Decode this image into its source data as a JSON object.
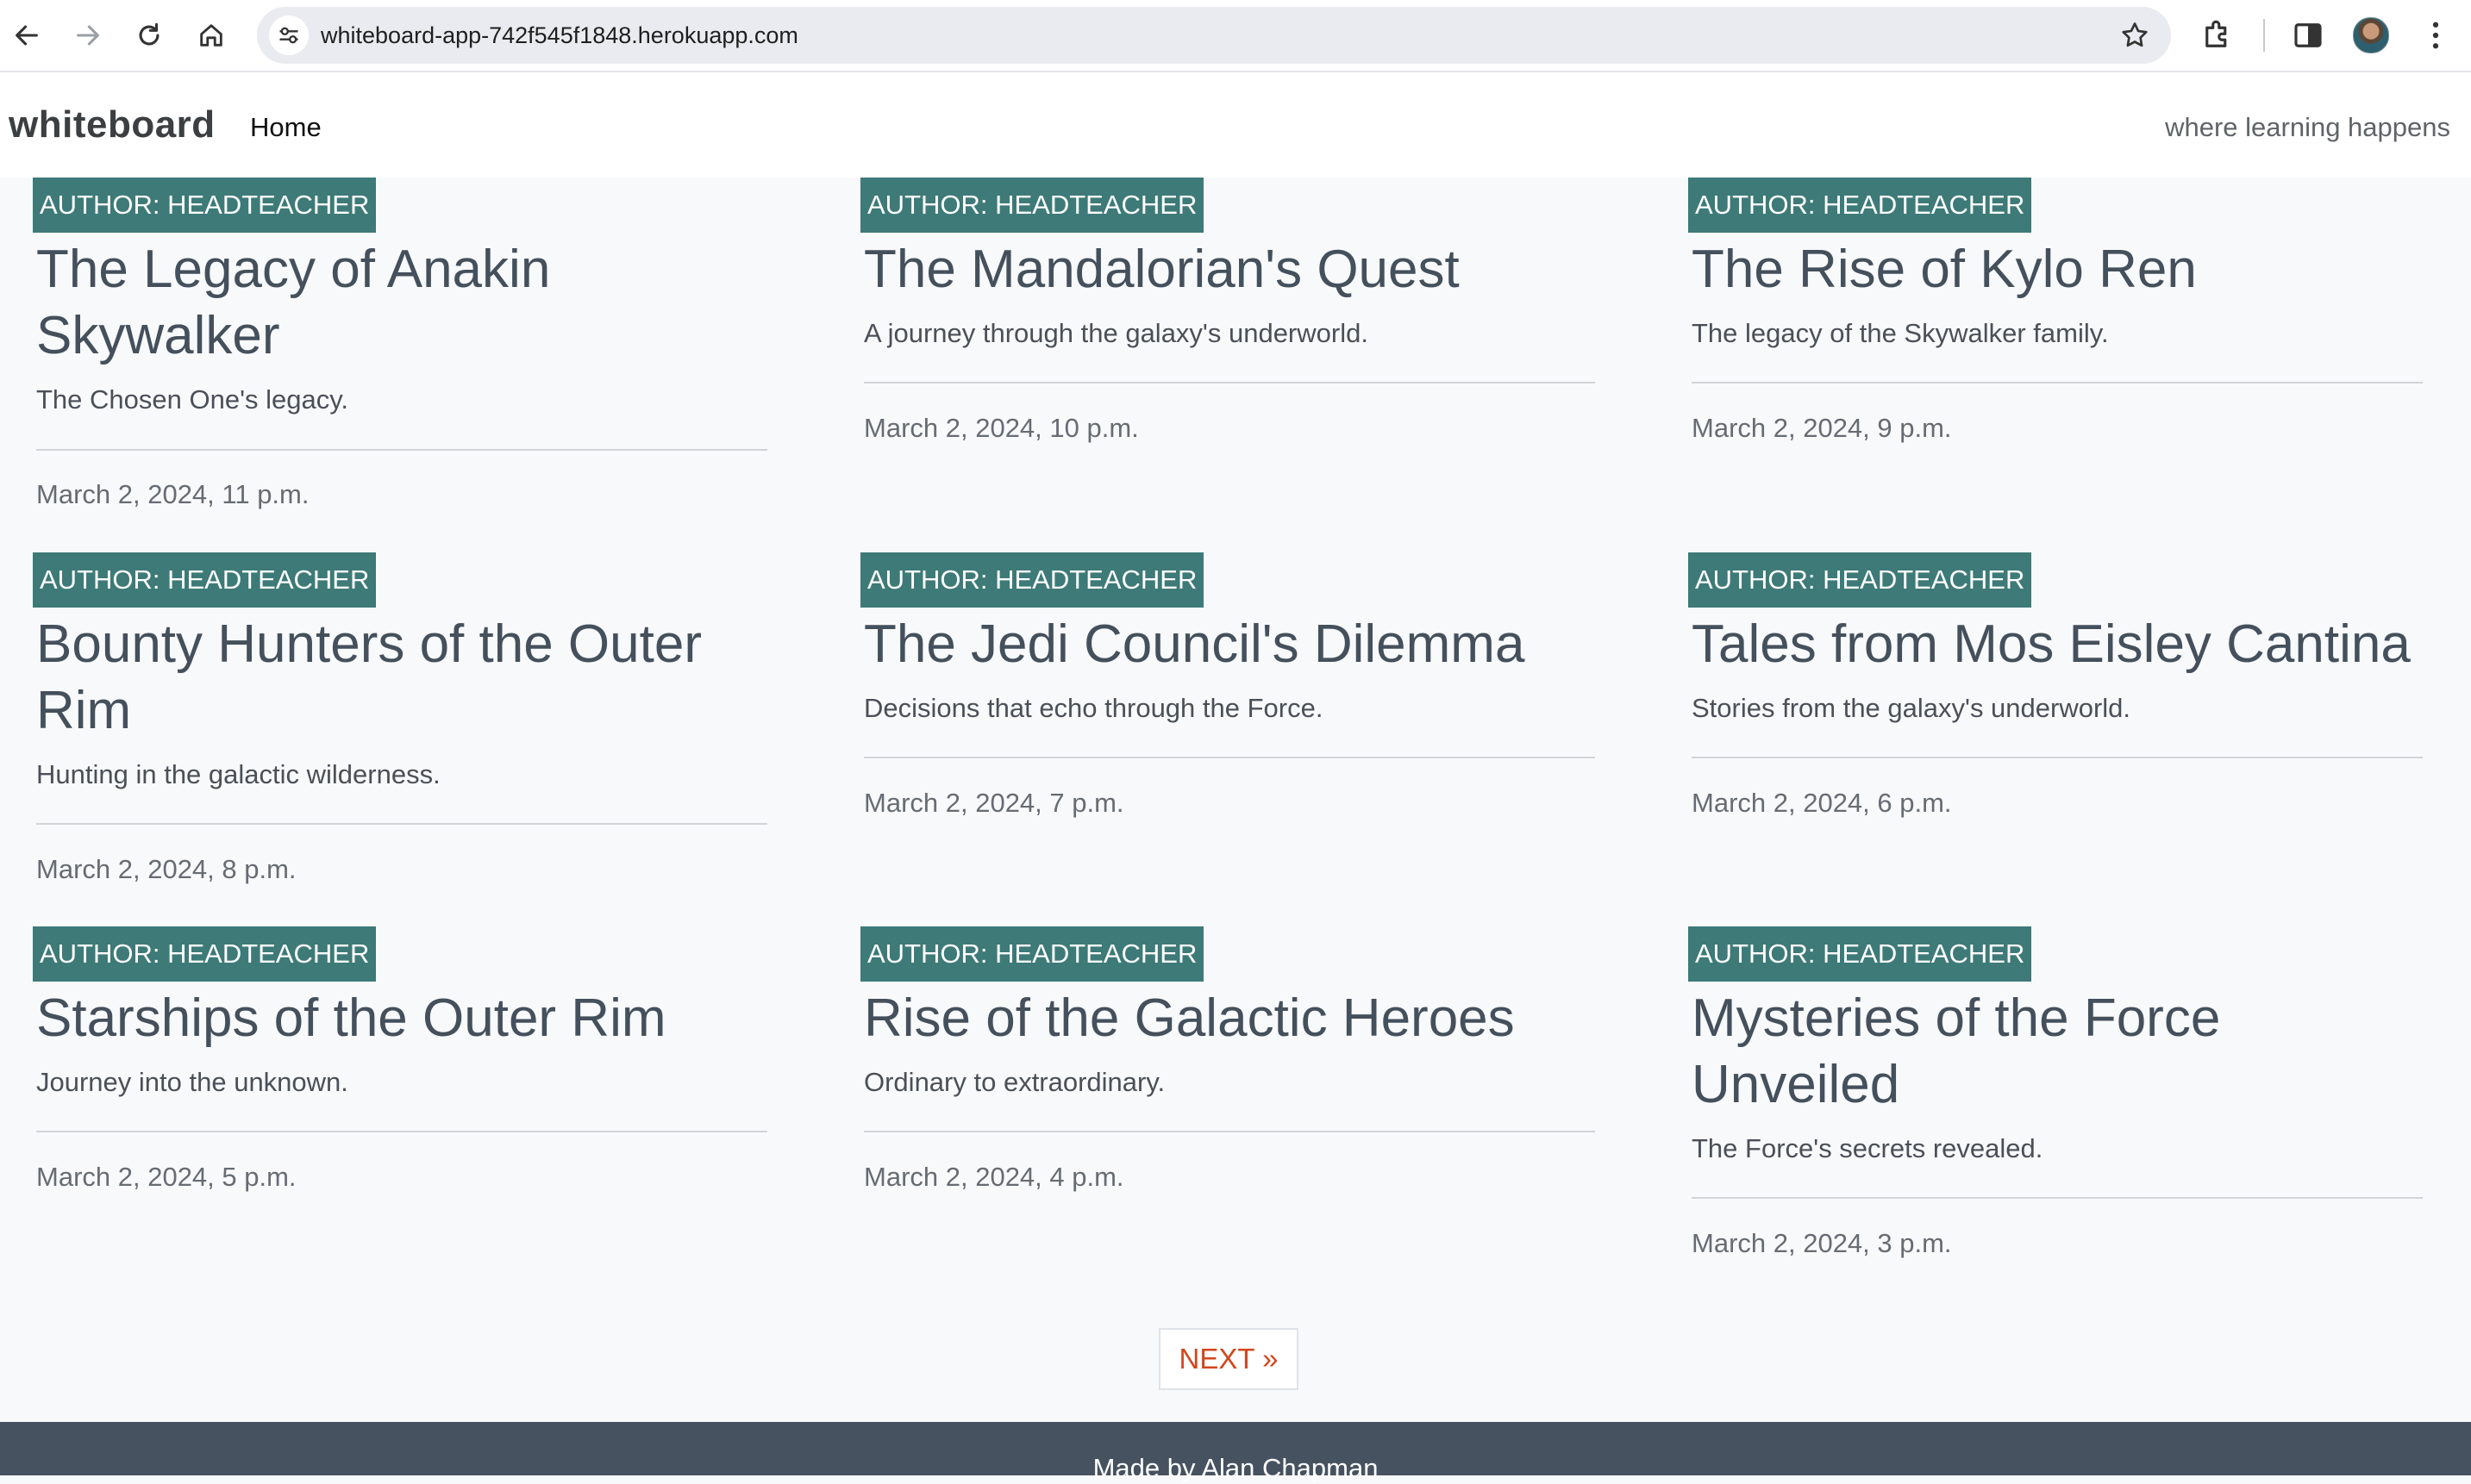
{
  "browser": {
    "url": "whiteboard-app-742f545f1848.herokuapp.com"
  },
  "navbar": {
    "brand": "whiteboard",
    "home_link": "Home",
    "tagline": "where learning happens"
  },
  "posts": [
    {
      "author": "AUTHOR: HEADTEACHER",
      "title": "The Legacy of Anakin Skywalker",
      "subtitle": "The Chosen One's legacy.",
      "date": "March 2, 2024, 11 p.m."
    },
    {
      "author": "AUTHOR: HEADTEACHER",
      "title": "The Mandalorian's Quest",
      "subtitle": "A journey through the galaxy's underworld.",
      "date": "March 2, 2024, 10 p.m."
    },
    {
      "author": "AUTHOR: HEADTEACHER",
      "title": "The Rise of Kylo Ren",
      "subtitle": "The legacy of the Skywalker family.",
      "date": "March 2, 2024, 9 p.m."
    },
    {
      "author": "AUTHOR: HEADTEACHER",
      "title": "Bounty Hunters of the Outer Rim",
      "subtitle": "Hunting in the galactic wilderness.",
      "date": "March 2, 2024, 8 p.m."
    },
    {
      "author": "AUTHOR: HEADTEACHER",
      "title": "The Jedi Council's Dilemma",
      "subtitle": "Decisions that echo through the Force.",
      "date": "March 2, 2024, 7 p.m."
    },
    {
      "author": "AUTHOR: HEADTEACHER",
      "title": "Tales from Mos Eisley Cantina",
      "subtitle": "Stories from the galaxy's underworld.",
      "date": "March 2, 2024, 6 p.m."
    },
    {
      "author": "AUTHOR: HEADTEACHER",
      "title": "Starships of the Outer Rim",
      "subtitle": "Journey into the unknown.",
      "date": "March 2, 2024, 5 p.m."
    },
    {
      "author": "AUTHOR: HEADTEACHER",
      "title": "Rise of the Galactic Heroes",
      "subtitle": "Ordinary to extraordinary.",
      "date": "March 2, 2024, 4 p.m."
    },
    {
      "author": "AUTHOR: HEADTEACHER",
      "title": "Mysteries of the Force Unveiled",
      "subtitle": "The Force's secrets revealed.",
      "date": "March 2, 2024, 3 p.m."
    }
  ],
  "pagination": {
    "next_label": "NEXT »"
  },
  "footer": {
    "text": "Made by Alan Chapman"
  },
  "colors": {
    "badge": "#3d7a78",
    "next_link": "#d2461c",
    "footer_bg": "#465260"
  }
}
